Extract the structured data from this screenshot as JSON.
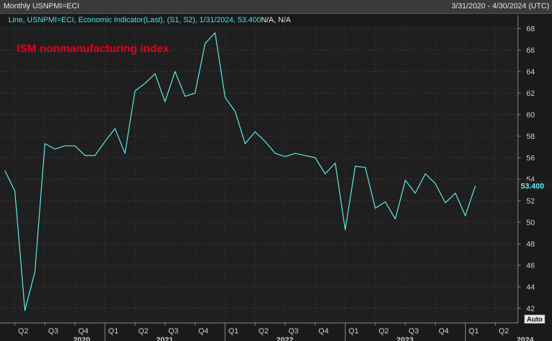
{
  "window": {
    "title": "Monthly USNPMI=ECI",
    "date_range": "3/31/2020 - 4/30/2024 (UTC)"
  },
  "legend": {
    "text": "Line, USNPMI=ECI, Economic Indicator(Last), (S1, S2), 1/31/2024, 53.400",
    "na_text": "N/A, N/A"
  },
  "annotation": "ISM nonmanufacturing index",
  "auto_button": "Auto",
  "chart_data": {
    "type": "line",
    "title": "",
    "ylabel": "",
    "xlabel": "",
    "ylim": [
      41,
      69
    ],
    "yticks": [
      42,
      44,
      46,
      48,
      50,
      52,
      54,
      56,
      58,
      60,
      62,
      64,
      66,
      68
    ],
    "grid": true,
    "last_value_label": "53.400",
    "quarter_ticks": [
      "Q2",
      "Q3",
      "Q4",
      "Q1",
      "Q2",
      "Q3",
      "Q4",
      "Q1",
      "Q2",
      "Q3",
      "Q4",
      "Q1",
      "Q2",
      "Q3",
      "Q4",
      "Q1",
      "Q2"
    ],
    "year_labels": [
      "2020",
      "2021",
      "2022",
      "2023",
      "2024"
    ],
    "series": [
      {
        "values": [
          {
            "x": "2020-03",
            "y": 54.8
          },
          {
            "x": "2020-04",
            "y": 52.9
          },
          {
            "x": "2020-05",
            "y": 41.8
          },
          {
            "x": "2020-06",
            "y": 45.4
          },
          {
            "x": "2020-07",
            "y": 57.3
          },
          {
            "x": "2020-08",
            "y": 56.8
          },
          {
            "x": "2020-09",
            "y": 57.1
          },
          {
            "x": "2020-10",
            "y": 57.1
          },
          {
            "x": "2020-11",
            "y": 56.2
          },
          {
            "x": "2020-12",
            "y": 56.2
          },
          {
            "x": "2021-01",
            "y": 57.5
          },
          {
            "x": "2021-02",
            "y": 58.7
          },
          {
            "x": "2021-03",
            "y": 56.4
          },
          {
            "x": "2021-04",
            "y": 62.2
          },
          {
            "x": "2021-05",
            "y": 62.9
          },
          {
            "x": "2021-06",
            "y": 63.8
          },
          {
            "x": "2021-07",
            "y": 61.2
          },
          {
            "x": "2021-08",
            "y": 64.0
          },
          {
            "x": "2021-09",
            "y": 61.7
          },
          {
            "x": "2021-10",
            "y": 62.0
          },
          {
            "x": "2021-11",
            "y": 66.6
          },
          {
            "x": "2021-12",
            "y": 67.6
          },
          {
            "x": "2022-01",
            "y": 61.6
          },
          {
            "x": "2022-02",
            "y": 60.3
          },
          {
            "x": "2022-03",
            "y": 57.3
          },
          {
            "x": "2022-04",
            "y": 58.4
          },
          {
            "x": "2022-05",
            "y": 57.5
          },
          {
            "x": "2022-06",
            "y": 56.4
          },
          {
            "x": "2022-07",
            "y": 56.1
          },
          {
            "x": "2022-08",
            "y": 56.4
          },
          {
            "x": "2022-09",
            "y": 56.2
          },
          {
            "x": "2022-10",
            "y": 56.0
          },
          {
            "x": "2022-11",
            "y": 54.5
          },
          {
            "x": "2022-12",
            "y": 55.5
          },
          {
            "x": "2023-01",
            "y": 49.3
          },
          {
            "x": "2023-02",
            "y": 55.2
          },
          {
            "x": "2023-03",
            "y": 55.1
          },
          {
            "x": "2023-04",
            "y": 51.3
          },
          {
            "x": "2023-05",
            "y": 51.9
          },
          {
            "x": "2023-06",
            "y": 50.3
          },
          {
            "x": "2023-07",
            "y": 53.9
          },
          {
            "x": "2023-08",
            "y": 52.7
          },
          {
            "x": "2023-09",
            "y": 54.5
          },
          {
            "x": "2023-10",
            "y": 53.6
          },
          {
            "x": "2023-11",
            "y": 51.8
          },
          {
            "x": "2023-12",
            "y": 52.7
          },
          {
            "x": "2024-01",
            "y": 50.6
          },
          {
            "x": "2024-02",
            "y": 53.4
          }
        ]
      }
    ]
  }
}
